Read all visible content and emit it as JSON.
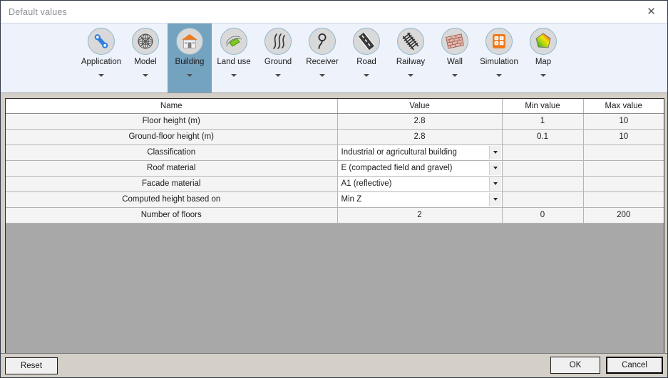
{
  "window": {
    "title": "Default values",
    "close_icon": "close-icon",
    "close_glyph": "✕"
  },
  "ribbon": {
    "selected": "Building",
    "items": [
      {
        "label": "Application",
        "icon": "wrench-icon"
      },
      {
        "label": "Model",
        "icon": "wireframe-sphere-icon"
      },
      {
        "label": "Building",
        "icon": "house-icon"
      },
      {
        "label": "Land use",
        "icon": "land-patch-icon"
      },
      {
        "label": "Ground",
        "icon": "wavy-lines-icon"
      },
      {
        "label": "Receiver",
        "icon": "microphone-icon"
      },
      {
        "label": "Road",
        "icon": "road-icon"
      },
      {
        "label": "Railway",
        "icon": "railway-track-icon"
      },
      {
        "label": "Wall",
        "icon": "brick-wall-icon"
      },
      {
        "label": "Simulation",
        "icon": "calculator-icon"
      },
      {
        "label": "Map",
        "icon": "color-map-icon"
      }
    ]
  },
  "table": {
    "columns": [
      "Name",
      "Value",
      "Min value",
      "Max value"
    ],
    "rows": [
      {
        "name": "Floor height (m)",
        "value": "2.8",
        "type": "number",
        "min": "1",
        "max": "10"
      },
      {
        "name": "Ground-floor height (m)",
        "value": "2.8",
        "type": "number",
        "min": "0.1",
        "max": "10"
      },
      {
        "name": "Classification",
        "value": "Industrial or agricultural building",
        "type": "dropdown",
        "min": "",
        "max": ""
      },
      {
        "name": "Roof material",
        "value": "E (compacted field and gravel)",
        "type": "dropdown",
        "min": "",
        "max": ""
      },
      {
        "name": "Facade material",
        "value": "A1 (reflective)",
        "type": "dropdown",
        "min": "",
        "max": ""
      },
      {
        "name": "Computed height based on",
        "value": "Min Z",
        "type": "dropdown",
        "min": "",
        "max": ""
      },
      {
        "name": "Number of floors",
        "value": "2",
        "type": "number",
        "min": "0",
        "max": "200"
      }
    ]
  },
  "footer": {
    "reset_label": "Reset",
    "ok_label": "OK",
    "cancel_label": "Cancel"
  },
  "colors": {
    "ribbon_background": "#eef2fa",
    "ribbon_selected": "#74a3c0",
    "name_text": "#1a7a3c",
    "grid_filler": "#a8a8a8",
    "footer_background": "#d4d0c8"
  }
}
